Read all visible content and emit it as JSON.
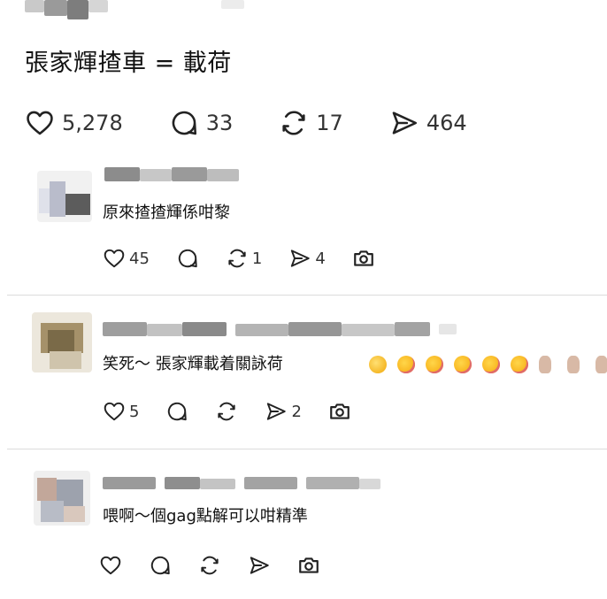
{
  "post": {
    "title": "張家輝揸車 = 載荷",
    "likes": "5,278",
    "comments": "33",
    "reposts": "17",
    "shares": "464"
  },
  "comments": [
    {
      "text": "原來揸揸輝係咁黎",
      "likes": "45",
      "reposts": "1",
      "shares": "4"
    },
    {
      "text": "笑死～ 張家輝載着關詠荷",
      "likes": "5",
      "reposts": "",
      "shares": "2"
    },
    {
      "text": "喂啊～個gag點解可以咁精準",
      "likes": "",
      "reposts": "",
      "shares": ""
    }
  ],
  "icons": [
    "heart-icon",
    "comment-icon",
    "repost-icon",
    "share-icon",
    "camera-icon"
  ],
  "colors": {
    "text": "#111111",
    "icon": "#222222",
    "divider": "#dcdcdc"
  }
}
